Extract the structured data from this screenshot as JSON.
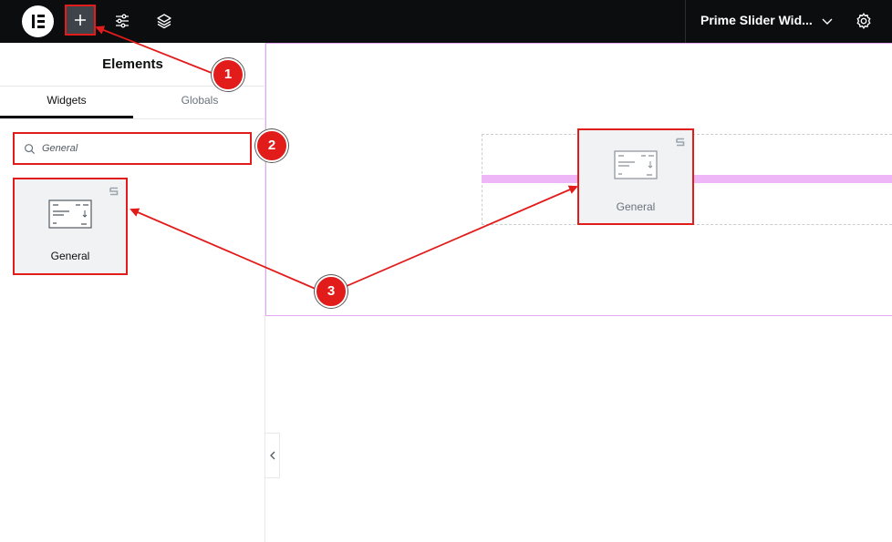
{
  "topbar": {
    "logo": "elementor-logo",
    "add_icon": "plus-icon",
    "settings_icon": "sliders-icon",
    "layers_icon": "layers-icon",
    "document_title": "Prime Slider Wid...",
    "document_chevron": "chevron-down-icon",
    "site_settings_icon": "gear-icon"
  },
  "panel": {
    "title": "Elements",
    "tabs": [
      {
        "label": "Widgets",
        "active": true
      },
      {
        "label": "Globals",
        "active": false
      }
    ],
    "search": {
      "value": "General",
      "icon": "search-icon"
    },
    "widgets": [
      {
        "label": "General",
        "icon": "general-widget-icon",
        "badge": "prime-slider-badge-icon"
      }
    ]
  },
  "canvas": {
    "dragged_widget": {
      "label": "General",
      "icon": "general-widget-icon",
      "badge": "prime-slider-badge-icon"
    },
    "collapse_icon": "chevron-left-icon"
  },
  "annotations": {
    "callouts": [
      "1",
      "2",
      "3"
    ],
    "color": "#e21b1b"
  },
  "colors": {
    "topbar": "#0c0d0e",
    "accent_outline": "#e21b1b",
    "drop_indicator": "#efb6f7",
    "section_outline": "#e4a8f2"
  }
}
